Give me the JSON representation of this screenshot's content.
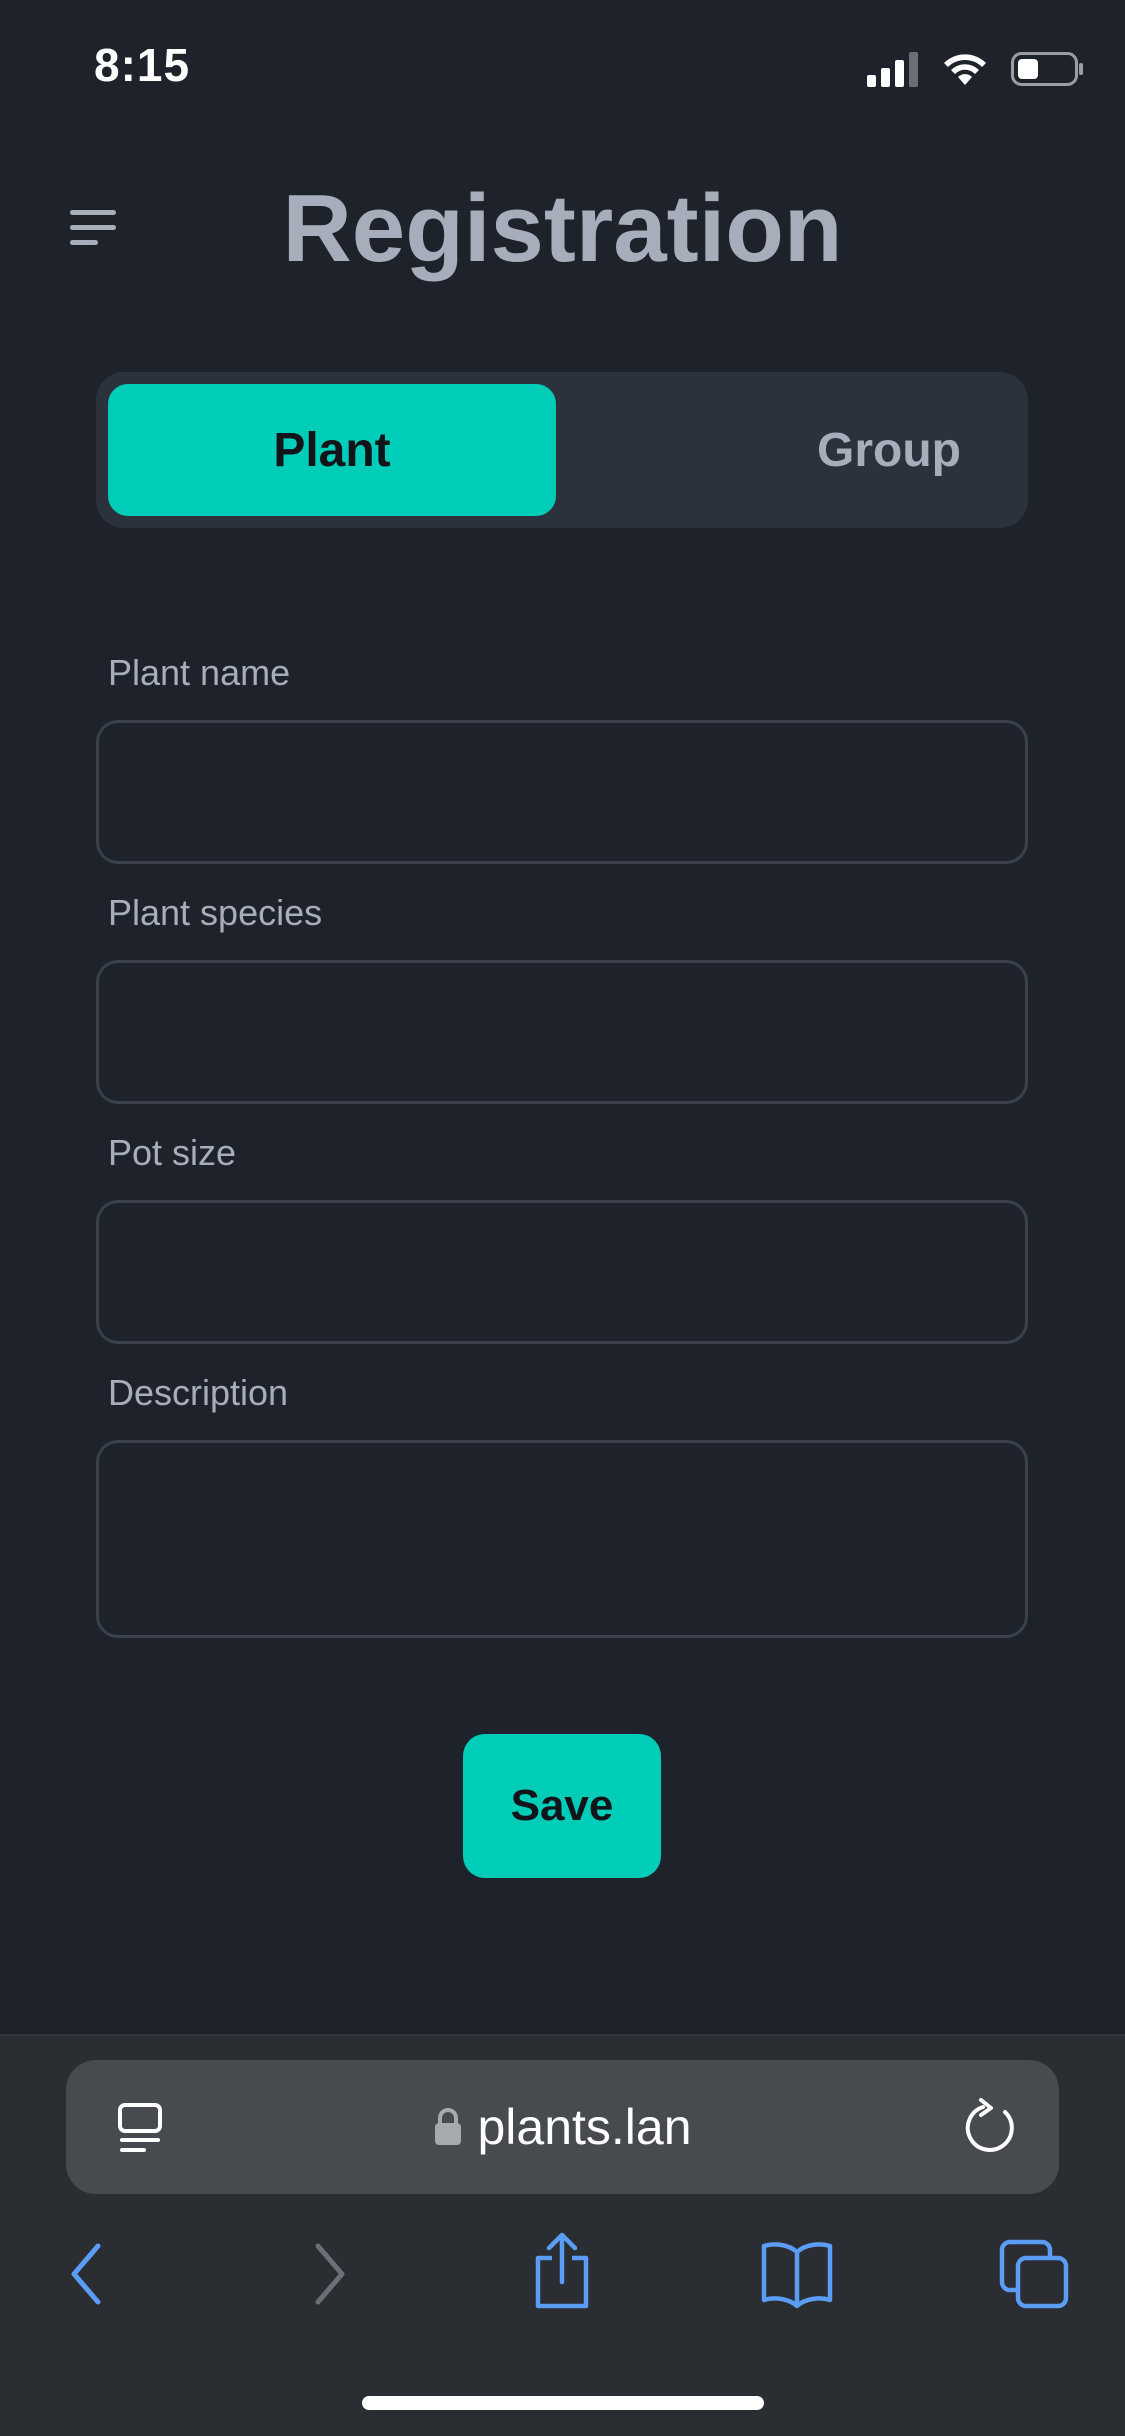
{
  "status_bar": {
    "time": "8:15"
  },
  "header": {
    "title": "Registration",
    "menu_icon": "hamburger-menu-icon"
  },
  "segmented": {
    "options": [
      "Plant",
      "Group"
    ],
    "selected": "Plant"
  },
  "form": {
    "fields": [
      {
        "label": "Plant name",
        "value": ""
      },
      {
        "label": "Plant species",
        "value": ""
      },
      {
        "label": "Pot size",
        "value": ""
      },
      {
        "label": "Description",
        "value": ""
      }
    ],
    "save_label": "Save"
  },
  "browser": {
    "url": "plants.lan",
    "icons": [
      "reader-icon",
      "lock-icon",
      "reload-icon",
      "back-icon",
      "forward-icon",
      "share-icon",
      "bookmarks-icon",
      "tabs-icon"
    ]
  },
  "colors": {
    "accent": "#00cdb8",
    "background": "#1e232b",
    "browser_link": "#5b9cf5"
  }
}
